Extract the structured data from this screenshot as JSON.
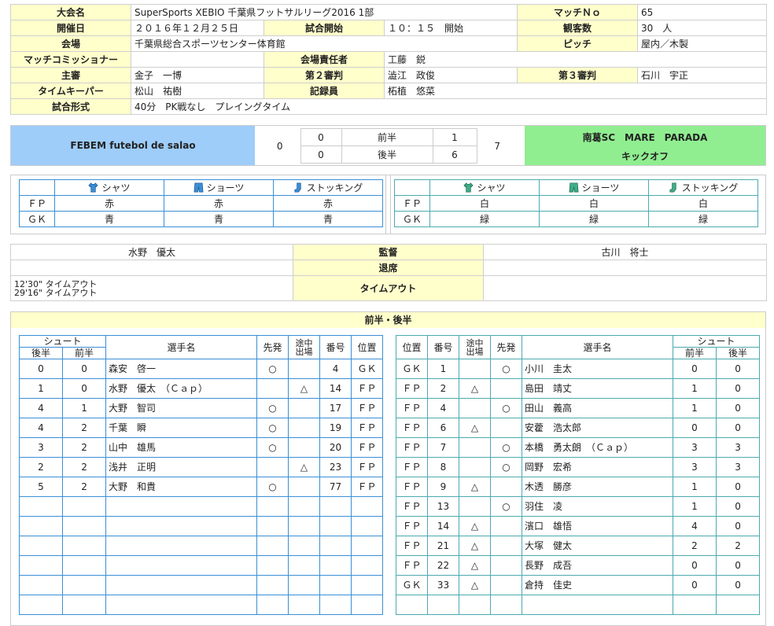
{
  "info": {
    "tournament_label": "大会名",
    "tournament": "SuperSports XEBIO 千葉県フットサルリーグ2016 1部",
    "match_no_label": "マッチＮｏ",
    "match_no": "65",
    "date_label": "開催日",
    "date": "２０１６年１２月２５日",
    "kickoff_label": "試合開始",
    "kickoff": "１０：１５　開始",
    "spectators_label": "観客数",
    "spectators": "30　人",
    "venue_label": "会場",
    "venue": "千葉県総合スポーツセンター体育館",
    "pitch_label": "ピッチ",
    "pitch": "屋内／木製",
    "commissioner_label": "マッチコミッショナー",
    "commissioner": "",
    "venue_manager_label": "会場責任者",
    "venue_manager": "工藤　鋭",
    "referee_label": "主審",
    "referee": "金子　一博",
    "referee2_label": "第２審判",
    "referee2": "澁江　政俊",
    "referee3_label": "第３審判",
    "referee3": "石川　宇正",
    "timekeeper_label": "タイムキーパー",
    "timekeeper": "松山　祐樹",
    "recorder_label": "記録員",
    "recorder": "柘植　悠菜",
    "format_label": "試合形式",
    "format": "40分　PK戦なし　プレイングタイム"
  },
  "score": {
    "home_team": "FEBEM futebol de salao",
    "away_team": "南葛SC　MARE　PARADA",
    "kickoff_note": "キックオフ",
    "home_total": "0",
    "away_total": "7",
    "first_half_label": "前半",
    "second_half_label": "後半",
    "home_first": "0",
    "home_second": "0",
    "away_first": "1",
    "away_second": "6"
  },
  "uniform": {
    "shirt_label": "シャツ",
    "shorts_label": "ショーツ",
    "socks_label": "ストッキング",
    "fp_label": "ＦＰ",
    "gk_label": "ＧＫ",
    "home": {
      "fp": [
        "赤",
        "赤",
        "赤"
      ],
      "gk": [
        "青",
        "青",
        "青"
      ],
      "color": "#3a8fd6"
    },
    "away": {
      "fp": [
        "白",
        "白",
        "白"
      ],
      "gk": [
        "緑",
        "緑",
        "緑"
      ],
      "color": "#3fae8a"
    }
  },
  "staff": {
    "coach_label": "監督",
    "dismissal_label": "退席",
    "timeout_label": "タイムアウト",
    "home_coach": "水野　優太",
    "away_coach": "古川　将士",
    "home_timeout_1": "12'30\" タイムアウト",
    "home_timeout_2": "29'16\" タイムアウト"
  },
  "roster": {
    "title": "前半・後半",
    "shoot_label": "シュート",
    "first_half": "前半",
    "second_half": "後半",
    "name_label": "選手名",
    "starter_label": "先発",
    "sub_label_1": "途中",
    "sub_label_2": "出場",
    "number_label": "番号",
    "position_label": "位置",
    "home_players": [
      {
        "s2": "0",
        "s1": "0",
        "name": "森安　啓一",
        "start": "○",
        "sub": "",
        "no": "4",
        "pos": "ＧＫ"
      },
      {
        "s2": "1",
        "s1": "0",
        "name": "水野　優太　（Ｃａｐ）",
        "start": "",
        "sub": "△",
        "no": "14",
        "pos": "ＦＰ"
      },
      {
        "s2": "4",
        "s1": "1",
        "name": "大野　智司",
        "start": "○",
        "sub": "",
        "no": "17",
        "pos": "ＦＰ"
      },
      {
        "s2": "4",
        "s1": "2",
        "name": "千葉　瞬",
        "start": "○",
        "sub": "",
        "no": "19",
        "pos": "ＦＰ"
      },
      {
        "s2": "3",
        "s1": "2",
        "name": "山中　雄馬",
        "start": "○",
        "sub": "",
        "no": "20",
        "pos": "ＦＰ"
      },
      {
        "s2": "2",
        "s1": "2",
        "name": "浅井　正明",
        "start": "",
        "sub": "△",
        "no": "23",
        "pos": "ＦＰ"
      },
      {
        "s2": "5",
        "s1": "2",
        "name": "大野　和貴",
        "start": "○",
        "sub": "",
        "no": "77",
        "pos": "ＦＰ"
      }
    ],
    "away_players": [
      {
        "pos": "ＧＫ",
        "no": "1",
        "sub": "",
        "start": "○",
        "name": "小川　圭太",
        "s1": "0",
        "s2": "0"
      },
      {
        "pos": "ＦＰ",
        "no": "2",
        "sub": "△",
        "start": "",
        "name": "島田　靖丈",
        "s1": "1",
        "s2": "0"
      },
      {
        "pos": "ＦＰ",
        "no": "4",
        "sub": "",
        "start": "○",
        "name": "田山　義高",
        "s1": "1",
        "s2": "0"
      },
      {
        "pos": "ＦＰ",
        "no": "6",
        "sub": "△",
        "start": "",
        "name": "安藿　浩太郎",
        "s1": "0",
        "s2": "0"
      },
      {
        "pos": "ＦＰ",
        "no": "7",
        "sub": "",
        "start": "○",
        "name": "本橋　勇太朗　（Ｃａｐ）",
        "s1": "3",
        "s2": "3"
      },
      {
        "pos": "ＦＰ",
        "no": "8",
        "sub": "",
        "start": "○",
        "name": "岡野　宏希",
        "s1": "3",
        "s2": "3"
      },
      {
        "pos": "ＦＰ",
        "no": "9",
        "sub": "△",
        "start": "",
        "name": "木透　勝彦",
        "s1": "1",
        "s2": "0"
      },
      {
        "pos": "ＦＰ",
        "no": "13",
        "sub": "",
        "start": "○",
        "name": "羽住　凌",
        "s1": "1",
        "s2": "0"
      },
      {
        "pos": "ＦＰ",
        "no": "14",
        "sub": "△",
        "start": "",
        "name": "濱口　雄悟",
        "s1": "4",
        "s2": "0"
      },
      {
        "pos": "ＦＰ",
        "no": "21",
        "sub": "△",
        "start": "",
        "name": "大塚　健太",
        "s1": "2",
        "s2": "2"
      },
      {
        "pos": "ＦＰ",
        "no": "22",
        "sub": "△",
        "start": "",
        "name": "長野　成吾",
        "s1": "0",
        "s2": "0"
      },
      {
        "pos": "ＧＫ",
        "no": "33",
        "sub": "△",
        "start": "",
        "name": "倉持　佳史",
        "s1": "0",
        "s2": "0"
      }
    ]
  }
}
